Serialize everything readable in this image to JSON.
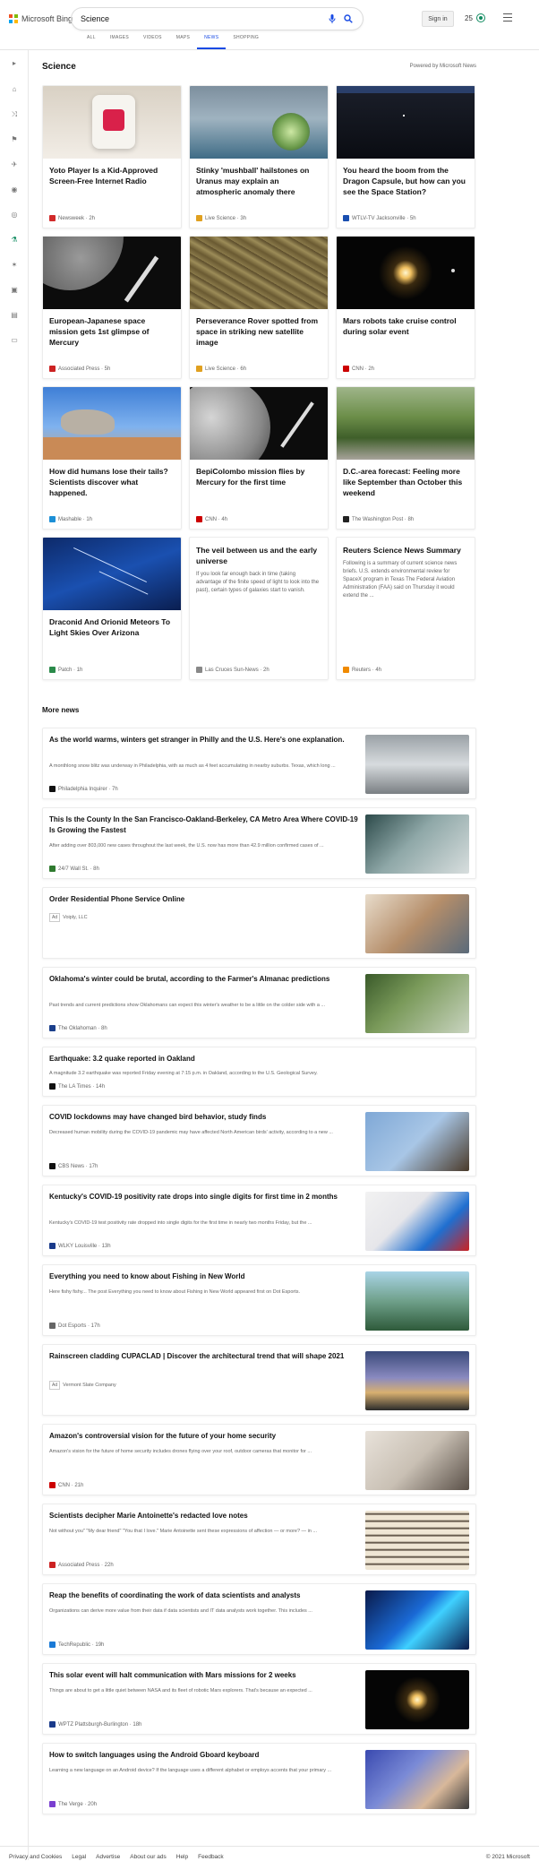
{
  "header": {
    "logo_text": "Microsoft Bing",
    "search_value": "Science",
    "signin_label": "Sign in",
    "points": "25",
    "tabs": [
      {
        "label": "ALL",
        "active": false
      },
      {
        "label": "IMAGES",
        "active": false
      },
      {
        "label": "VIDEOS",
        "active": false
      },
      {
        "label": "MAPS",
        "active": false
      },
      {
        "label": "NEWS",
        "active": true
      },
      {
        "label": "SHOPPING",
        "active": false
      }
    ]
  },
  "section": {
    "title": "Science",
    "powered": "Powered by Microsoft News"
  },
  "cards": [
    {
      "title": "Yoto Player Is a Kid-Approved Screen-Free Internet Radio",
      "source": "Newsweek · 2h",
      "fav": "#d12a2a"
    },
    {
      "title": "Stinky 'mushball' hailstones on Uranus may explain an atmospheric anomaly there",
      "source": "Live Science · 3h",
      "fav": "#e0a020"
    },
    {
      "title": "You heard the boom from the Dragon Capsule, but how can you see the Space Station?",
      "source": "WTLV-TV Jacksonville · 5h",
      "fav": "#1a4fb0"
    },
    {
      "title": "European-Japanese space mission gets 1st glimpse of Mercury",
      "source": "Associated Press · 5h",
      "fav": "#c22"
    },
    {
      "title": "Perseverance Rover spotted from space in striking new satellite image",
      "source": "Live Science · 6h",
      "fav": "#e0a020"
    },
    {
      "title": "Mars robots take cruise control during solar event",
      "source": "CNN · 2h",
      "fav": "#cc0000"
    },
    {
      "title": "How did humans lose their tails? Scientists discover what happened.",
      "source": "Mashable · 1h",
      "fav": "#1c8fd6"
    },
    {
      "title": "BepiColombo mission flies by Mercury for the first time",
      "source": "CNN · 4h",
      "fav": "#cc0000"
    },
    {
      "title": "D.C.-area forecast: Feeling more like September than October this weekend",
      "source": "The Washington Post · 8h",
      "fav": "#222"
    },
    {
      "title": "Draconid And Orionid Meteors To Light Skies Over Arizona",
      "source": "Patch · 1h",
      "fav": "#2a8a4a"
    },
    {
      "title": "The veil between us and the early universe",
      "snippet": "If you look far enough back in time (taking advantage of the finite speed of light to look into the past), certain types of galaxies start to vanish.",
      "source": "Las Cruces Sun-News · 2h",
      "fav": "#888"
    },
    {
      "title": "Reuters Science News Summary",
      "snippet": "Following is a summary of current science news briefs. U.S. extends environmental review for SpaceX program in Texas The Federal Aviation Administration (FAA) said on Thursday it would extend the ...",
      "source": "Reuters · 4h",
      "fav": "#f08a00"
    }
  ],
  "more_news_title": "More news",
  "more_news": [
    {
      "title": "As the world warms, winters get stranger in Philly and the U.S. Here's one explanation.",
      "snippet": "A monthlong snow blitz was underway in Philadelphia, with as much as 4 feet accumulating in nearby suburbs. Texas, which long ...",
      "source": "Philadelphia Inquirer · 7h",
      "fav": "#111",
      "ad": ""
    },
    {
      "title": "This Is the County In the San Francisco-Oakland-Berkeley, CA Metro Area Where COVID-19 Is Growing the Fastest",
      "snippet": "After adding over 803,000 new cases throughout the last week, the U.S. now has more than 42.9 million confirmed cases of ...",
      "source": "24/7 Wall St. · 8h",
      "fav": "#2f7a2f",
      "ad": ""
    },
    {
      "title": "Order Residential Phone Service Online",
      "snippet": "",
      "source": "Voiply, LLC",
      "fav": "",
      "ad": "Ad"
    },
    {
      "title": "Oklahoma's winter could be brutal, according to the Farmer's Almanac predictions",
      "snippet": "Past trends and current predictions show Oklahomans can expect this winter's weather to be a little on the colder side with a ...",
      "source": "The Oklahoman · 8h",
      "fav": "#1b3f8b",
      "ad": ""
    },
    {
      "title": "Earthquake: 3.2 quake reported in Oakland",
      "snippet": "A magnitude 3.2 earthquake was reported Friday evening at 7:15 p.m. in Oakland, according to the U.S. Geological Survey.",
      "source": "The LA Times · 14h",
      "fav": "#111",
      "ad": ""
    },
    {
      "title": "COVID lockdowns may have changed bird behavior, study finds",
      "snippet": "Decreased human mobility during the COVID-19 pandemic may have affected North American birds' activity, according to a new ...",
      "source": "CBS News · 17h",
      "fav": "#111",
      "ad": ""
    },
    {
      "title": "Kentucky's COVID-19 positivity rate drops into single digits for first time in 2 months",
      "snippet": "Kentucky's COVID-19 test positivity rate dropped into single digits for the first time in nearly two months Friday, but the ...",
      "source": "WLKY Louisville · 13h",
      "fav": "#1a3a8a",
      "ad": ""
    },
    {
      "title": "Everything you need to know about Fishing in New World",
      "snippet": "Here fishy fishy... The post Everything you need to know about Fishing in New World appeared first on Dot Esports.",
      "source": "Dot Esports · 17h",
      "fav": "#666",
      "ad": ""
    },
    {
      "title": "Rainscreen cladding CUPACLAD | Discover the architectural trend that will shape 2021",
      "snippet": "",
      "source": "Vermont Slate Company",
      "fav": "",
      "ad": "Ad"
    },
    {
      "title": "Amazon's controversial vision for the future of your home security",
      "snippet": "Amazon's vision for the future of home security includes drones flying over your roof, outdoor cameras that monitor for ...",
      "source": "CNN · 21h",
      "fav": "#cc0000",
      "ad": ""
    },
    {
      "title": "Scientists decipher Marie Antoinette's redacted love notes",
      "snippet": "Not without you\" \"My dear friend\" \"You that I love.\" Marie Antoinette sent these expressions of affection — or more? — in ...",
      "source": "Associated Press · 22h",
      "fav": "#c22",
      "ad": ""
    },
    {
      "title": "Reap the benefits of coordinating the work of data scientists and analysts",
      "snippet": "Organizations can derive more value from their data if data scientists and IT data analysts work together. This includes ...",
      "source": "TechRepublic · 19h",
      "fav": "#1a7ad6",
      "ad": ""
    },
    {
      "title": "This solar event will halt communication with Mars missions for 2 weeks",
      "snippet": "Things are about to get a little quiet between NASA and its fleet of robotic Mars explorers. That's because an expected ...",
      "source": "WPTZ Plattsburgh-Burlington · 18h",
      "fav": "#1a3a8a",
      "ad": ""
    },
    {
      "title": "How to switch languages using the Android Gboard keyboard",
      "snippet": "Learning a new language on an Android device? If the language uses a different alphabet or employs accents that your primary ...",
      "source": "The Verge · 20h",
      "fav": "#7a3fd0",
      "ad": ""
    }
  ],
  "footer": {
    "links": [
      "Privacy and Cookies",
      "Legal",
      "Advertise",
      "About our ads",
      "Help",
      "Feedback"
    ],
    "copyright": "© 2021 Microsoft"
  }
}
